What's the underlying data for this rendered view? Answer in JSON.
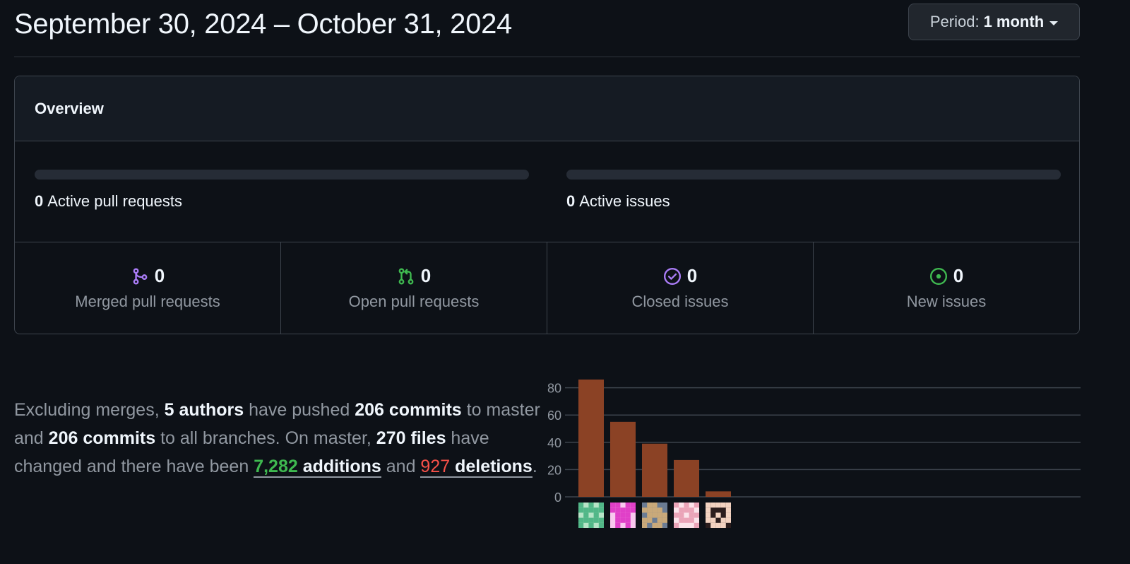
{
  "header": {
    "date_range": "September 30, 2024 – October 31, 2024",
    "period_label": "Period:",
    "period_value": "1 month"
  },
  "overview": {
    "title": "Overview",
    "active_prs": {
      "count": "0",
      "label": "Active pull requests"
    },
    "active_issues": {
      "count": "0",
      "label": "Active issues"
    },
    "stats": [
      {
        "icon": "git-merge-icon",
        "color": "#ab7df8",
        "count": "0",
        "label": "Merged pull requests"
      },
      {
        "icon": "git-pull-request-icon",
        "color": "#3fb950",
        "count": "0",
        "label": "Open pull requests"
      },
      {
        "icon": "issue-closed-icon",
        "color": "#ab7df8",
        "count": "0",
        "label": "Closed issues"
      },
      {
        "icon": "issue-opened-icon",
        "color": "#3fb950",
        "count": "0",
        "label": "New issues"
      }
    ]
  },
  "summary": {
    "t1": "Excluding merges, ",
    "authors": "5 authors",
    "t2": " have pushed ",
    "commits_master": "206 commits",
    "t3": " to master and ",
    "commits_all": "206 commits",
    "t4": " to all branches. On master, ",
    "files": "270 files",
    "t5": " have changed and there have been ",
    "additions_num": "7,282",
    "additions_word": " additions",
    "t6": " and ",
    "deletions_num": "927",
    "deletions_word": " deletions",
    "t7": "."
  },
  "chart_data": {
    "type": "bar",
    "categories": [
      "author-1",
      "author-2",
      "author-3",
      "author-4",
      "author-5"
    ],
    "values": [
      86,
      55,
      39,
      27,
      4
    ],
    "yticks": [
      "0",
      "20",
      "40",
      "60",
      "80"
    ],
    "ylim": [
      0,
      90
    ],
    "grid": true,
    "bar_color": "#8b4225",
    "x_axis_labels": "author avatars"
  }
}
